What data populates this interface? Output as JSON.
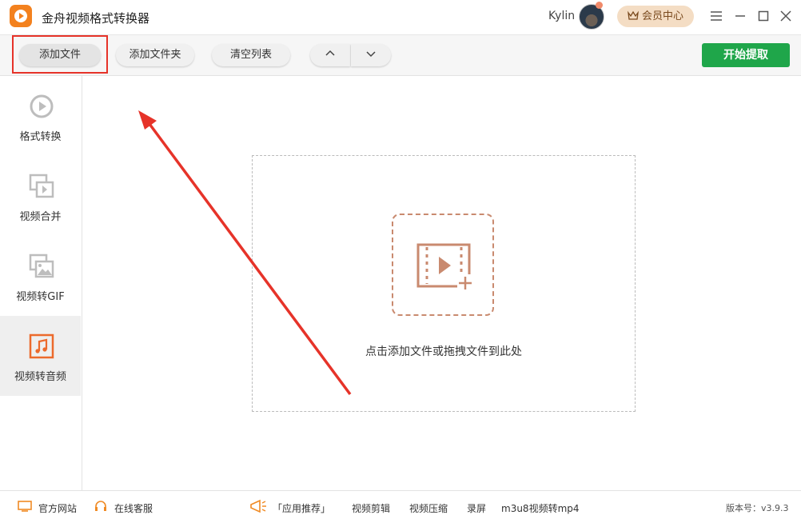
{
  "app": {
    "title": "金舟视频格式转换器"
  },
  "user": {
    "name": "Kylin",
    "member_label": "会员中心"
  },
  "toolbar": {
    "add_file": "添加文件",
    "add_folder": "添加文件夹",
    "clear_list": "清空列表",
    "start": "开始提取"
  },
  "sidebar": {
    "items": [
      {
        "label": "格式转换",
        "icon": "play-circle-icon"
      },
      {
        "label": "视频合并",
        "icon": "video-merge-icon"
      },
      {
        "label": "视频转GIF",
        "icon": "image-icon"
      },
      {
        "label": "视频转音频",
        "icon": "music-note-icon",
        "active": true
      }
    ]
  },
  "main": {
    "drop_hint": "点击添加文件或拖拽文件到此处"
  },
  "footer": {
    "website": "官方网站",
    "support": "在线客服",
    "recommend": "「应用推荐」",
    "links": [
      "视频剪辑",
      "视频压缩",
      "录屏",
      "m3u8视频转mp4"
    ],
    "version": "版本号：v3.9.3"
  },
  "colors": {
    "accent": "#f3811e",
    "start_button": "#1fa64a",
    "highlight": "#e63329",
    "drop_icon": "#c98a6f"
  }
}
